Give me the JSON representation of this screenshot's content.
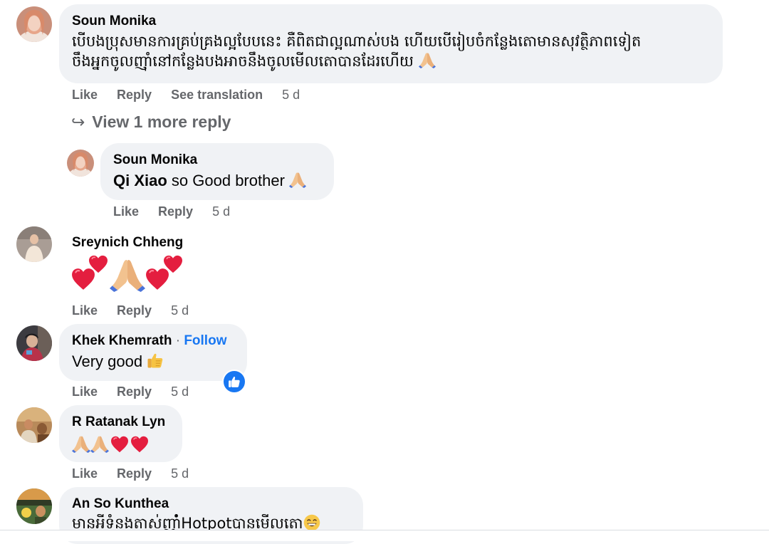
{
  "comments": [
    {
      "author": "Soun Monika",
      "line1": "បើបងប្រុសមានការគ្រប់គ្រងល្អបែបនេះ គឺពិតជាល្អណាស់បង ហើយបើរៀបចំកន្លែងតោមានសុវត្ថិភាពទៀត",
      "line2": "ចឹងអ្នកចូលញ៉ាំនៅកន្លែងបងអាចនឹងចូលមើលតោបានដែរហើយ",
      "like": "Like",
      "reply": "Reply",
      "see_translation": "See translation",
      "time": "5 d"
    },
    {
      "view_more": "View 1 more reply"
    },
    {
      "author": "Soun Monika",
      "mention": "Qi Xiao",
      "text": " so Good brother ",
      "like": "Like",
      "reply": "Reply",
      "time": "5 d"
    },
    {
      "author": "Sreynich Chheng",
      "like": "Like",
      "reply": "Reply",
      "time": "5 d"
    },
    {
      "author": "Khek Khemrath",
      "separator": " · ",
      "follow": "Follow",
      "text": "Very good ",
      "like": "Like",
      "reply": "Reply",
      "time": "5 d"
    },
    {
      "author": "R Ratanak Lyn",
      "like": "Like",
      "reply": "Reply",
      "time": "5 d"
    },
    {
      "author": "An So Kunthea",
      "text": "មានអីទំនងតាស់ញាំ៎Hotpotបានមើលតោ"
    }
  ],
  "icons": {
    "prayer": "folded-hands-icon",
    "heart": "red-heart-icon",
    "two_hearts": "two-hearts-icon",
    "thumbs": "thumbs-up-icon",
    "grin": "grinning-face-icon",
    "reaction": "like-reaction-icon",
    "reply_arrow": "reply-arrow-icon"
  },
  "colors": {
    "bubble": "#f0f2f5",
    "link": "#1877f2",
    "meta": "#65676b",
    "heart": "#e41e3f"
  }
}
